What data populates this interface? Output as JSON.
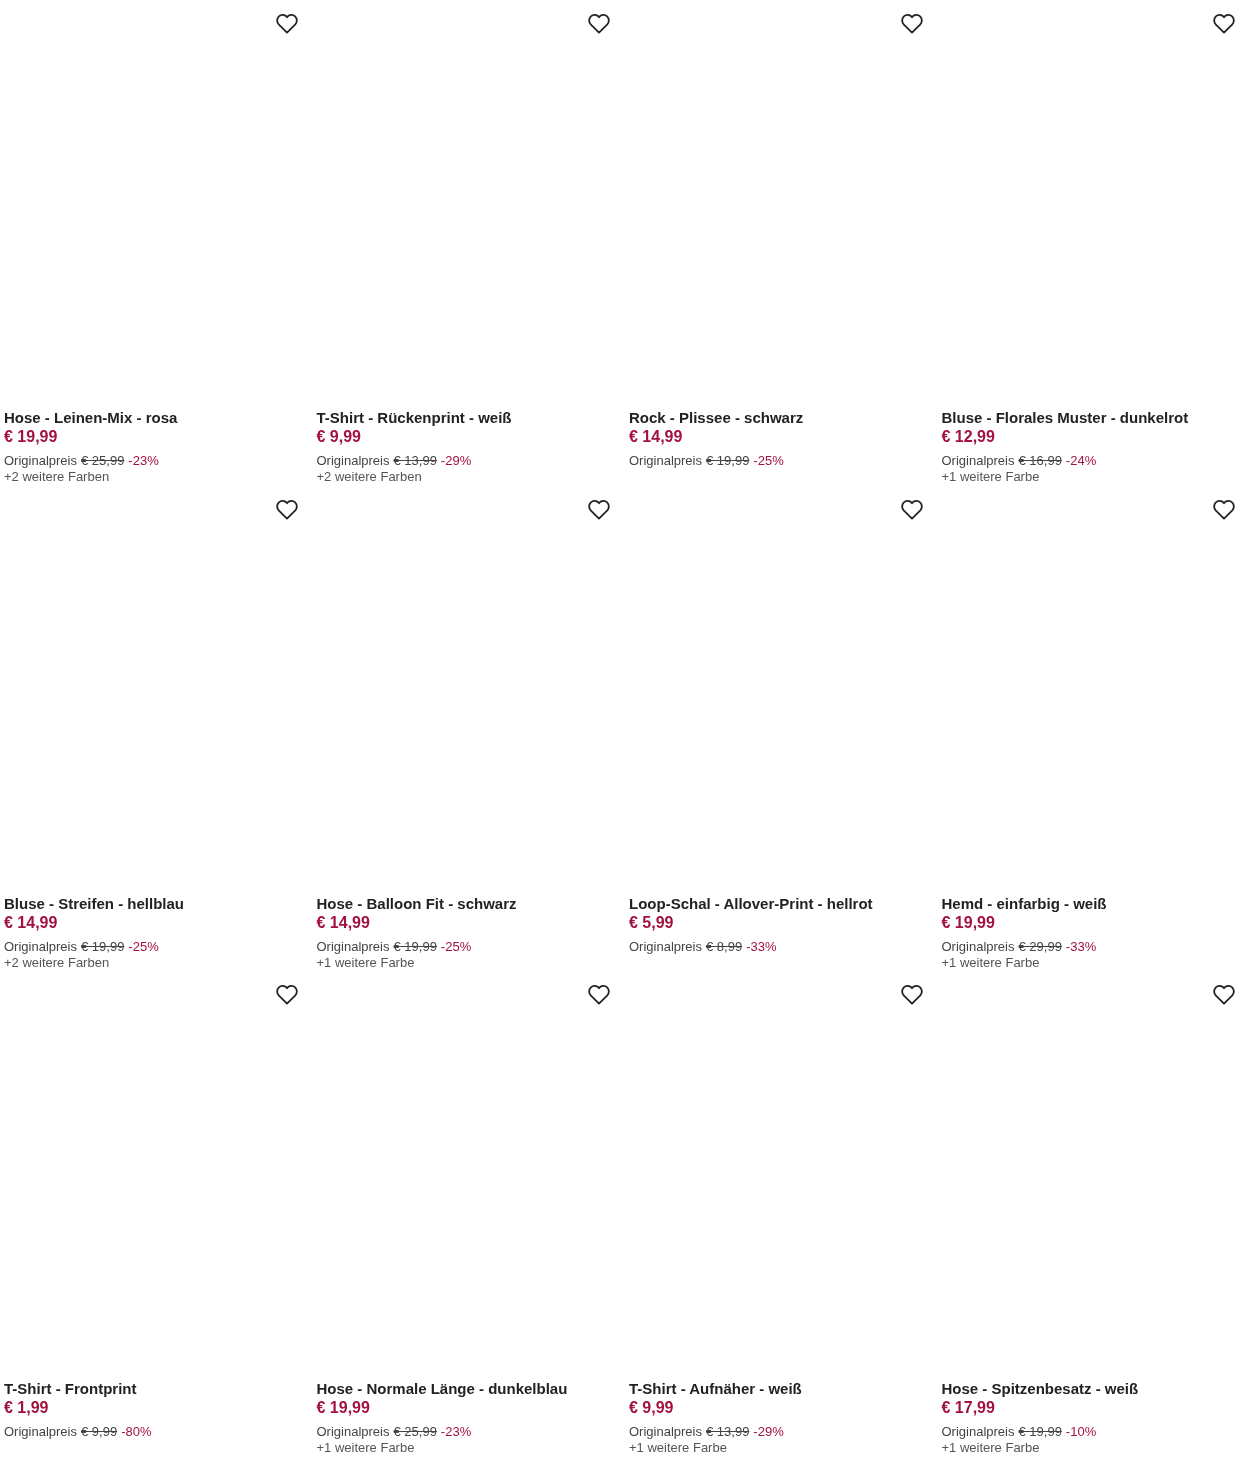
{
  "products": [
    {
      "title": "Hose - Leinen-Mix - rosa",
      "price": "€ 19,99",
      "original_label": "Originalpreis",
      "original_price": "€ 25,99",
      "discount": "-23%",
      "more_colors": "+2 weitere Farben",
      "favorite": false
    },
    {
      "title": "T-Shirt - Rückenprint - weiß",
      "price": "€ 9,99",
      "original_label": "Originalpreis",
      "original_price": "€ 13,99",
      "discount": "-29%",
      "more_colors": "+2 weitere Farben",
      "favorite": false
    },
    {
      "title": "Rock - Plissee - schwarz",
      "price": "€ 14,99",
      "original_label": "Originalpreis",
      "original_price": "€ 19,99",
      "discount": "-25%",
      "favorite": false
    },
    {
      "title": "Bluse - Florales Muster - dunkelrot",
      "price": "€ 12,99",
      "original_label": "Originalpreis",
      "original_price": "€ 16,99",
      "discount": "-24%",
      "more_colors": "+1 weitere Farbe",
      "favorite": false
    },
    {
      "title": "Bluse - Streifen - hellblau",
      "price": "€ 14,99",
      "original_label": "Originalpreis",
      "original_price": "€ 19,99",
      "discount": "-25%",
      "more_colors": "+2 weitere Farben",
      "favorite": false
    },
    {
      "title": "Hose - Balloon Fit - schwarz",
      "price": "€ 14,99",
      "original_label": "Originalpreis",
      "original_price": "€ 19,99",
      "discount": "-25%",
      "more_colors": "+1 weitere Farbe",
      "favorite": false
    },
    {
      "title": "Loop-Schal - Allover-Print - hellrot",
      "price": "€ 5,99",
      "original_label": "Originalpreis",
      "original_price": "€ 8,99",
      "discount": "-33%",
      "favorite": false
    },
    {
      "title": "Hemd - einfarbig - weiß",
      "price": "€ 19,99",
      "original_label": "Originalpreis",
      "original_price": "€ 29,99",
      "discount": "-33%",
      "more_colors": "+1 weitere Farbe",
      "favorite": false
    },
    {
      "title": "T-Shirt - Frontprint",
      "price": "€ 1,99",
      "original_label": "Originalpreis",
      "original_price": "€ 9,99",
      "discount": "-80%",
      "favorite": false
    },
    {
      "title": "Hose - Normale Länge - dunkelblau",
      "price": "€ 19,99",
      "original_label": "Originalpreis",
      "original_price": "€ 25,99",
      "discount": "-23%",
      "more_colors": "+1 weitere Farbe",
      "favorite": false
    },
    {
      "title": "T-Shirt - Aufnäher - weiß",
      "price": "€ 9,99",
      "original_label": "Originalpreis",
      "original_price": "€ 13,99",
      "discount": "-29%",
      "more_colors": "+1 weitere Farbe",
      "favorite": false
    },
    {
      "title": "Hose - Spitzenbesatz - weiß",
      "price": "€ 17,99",
      "original_label": "Originalpreis",
      "original_price": "€ 19,99",
      "discount": "-10%",
      "more_colors": "+1 weitere Farbe",
      "favorite": false
    }
  ]
}
